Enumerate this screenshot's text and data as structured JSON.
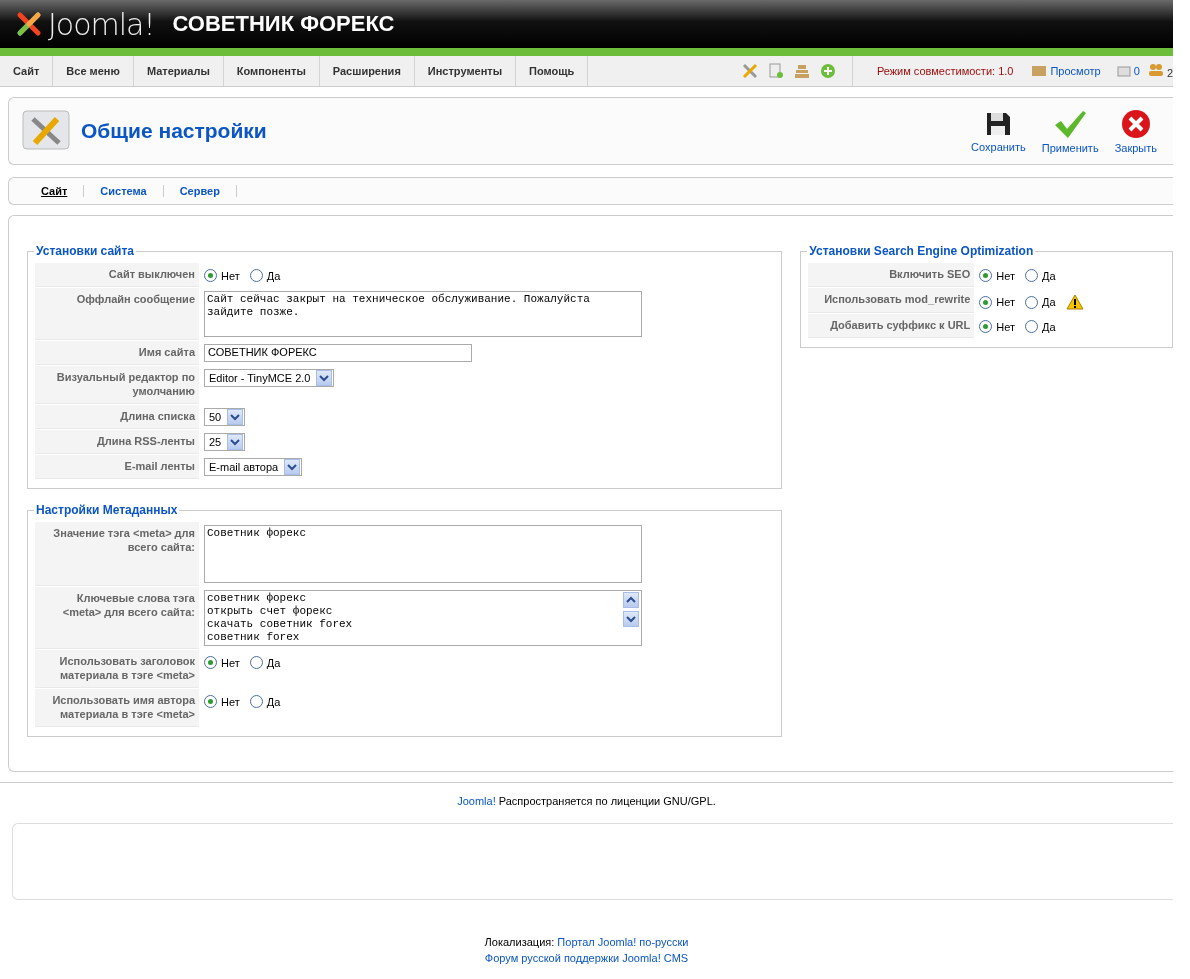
{
  "header": {
    "logo": "Joomla!",
    "site_title": "СОВЕТНИК ФОРЕКС"
  },
  "menu": [
    "Сайт",
    "Все меню",
    "Материалы",
    "Компоненты",
    "Расширения",
    "Инструменты",
    "Помощь"
  ],
  "status": {
    "compat": "Режим совместимости: 1.0",
    "preview": "Просмотр",
    "messages": "0",
    "users": "2"
  },
  "toolbar": {
    "title": "Общие настройки",
    "buttons": [
      {
        "kind": "save",
        "label": "Сохранить"
      },
      {
        "kind": "apply",
        "label": "Применить"
      },
      {
        "kind": "close",
        "label": "Закрыть"
      }
    ]
  },
  "tabs": [
    {
      "label": "Сайт",
      "selected": true
    },
    {
      "label": "Система",
      "selected": false
    },
    {
      "label": "Сервер",
      "selected": false
    }
  ],
  "left_groups": [
    {
      "legend": "Установки сайта",
      "rows": [
        {
          "label": "Сайт выключен",
          "kind": "radio",
          "options": [
            {
              "label": "Нет",
              "selected": true
            },
            {
              "label": "Да",
              "selected": false
            }
          ]
        },
        {
          "label": "Оффлайн сообщение",
          "kind": "textarea",
          "value": "Сайт сейчас закрыт на техническое обслуживание. Пожалуйста зайдите позже."
        },
        {
          "label": "Имя сайта",
          "kind": "text",
          "value": "СОВЕТНИК ФОРЕКС"
        },
        {
          "label": "Визуальный редактор по умолчанию",
          "kind": "select",
          "value": "Editor - TinyMCE 2.0"
        },
        {
          "label": "Длина списка",
          "kind": "select",
          "value": "50"
        },
        {
          "label": "Длина RSS-ленты",
          "kind": "select",
          "value": "25"
        },
        {
          "label": "E-mail ленты",
          "kind": "select",
          "value": "E-mail автора"
        }
      ]
    },
    {
      "legend": "Настройки Метаданных",
      "rows": [
        {
          "label": "Значение тэга <meta> для всего сайта:",
          "kind": "textarea",
          "value": "Советник форекс"
        },
        {
          "label": "Ключевые слова тэга <meta> для всего сайта:",
          "kind": "scrollarea",
          "lines": [
            "советник форекс",
            "открыть счет форекс",
            "скачать советник forex",
            "советник forex"
          ]
        },
        {
          "label": "Использовать заголовок материала в тэге <meta>",
          "kind": "radio",
          "options": [
            {
              "label": "Нет",
              "selected": true
            },
            {
              "label": "Да",
              "selected": false
            }
          ]
        },
        {
          "label": "Использовать имя автора материала в тэге <meta>",
          "kind": "radio",
          "options": [
            {
              "label": "Нет",
              "selected": true
            },
            {
              "label": "Да",
              "selected": false
            }
          ]
        }
      ]
    }
  ],
  "right_groups": [
    {
      "legend": "Установки Search Engine Optimization",
      "rows": [
        {
          "label": "Включить SEO",
          "kind": "radio",
          "options": [
            {
              "label": "Нет",
              "selected": true
            },
            {
              "label": "Да",
              "selected": false
            }
          ]
        },
        {
          "label": "Использовать mod_rewrite",
          "kind": "radio",
          "warning": true,
          "options": [
            {
              "label": "Нет",
              "selected": true
            },
            {
              "label": "Да",
              "selected": false
            }
          ]
        },
        {
          "label": "Добавить суффикс к URL",
          "kind": "radio",
          "options": [
            {
              "label": "Нет",
              "selected": true
            },
            {
              "label": "Да",
              "selected": false
            }
          ]
        }
      ]
    }
  ],
  "footer": {
    "license_link": "Joomla!",
    "license_text": "Распространяется по лиценции GNU/GPL.",
    "loc_label": "Локализация:",
    "loc_link": "Портал Joomla! по-русски",
    "forum_link": "Форум русской поддержки Joomla! CMS"
  }
}
